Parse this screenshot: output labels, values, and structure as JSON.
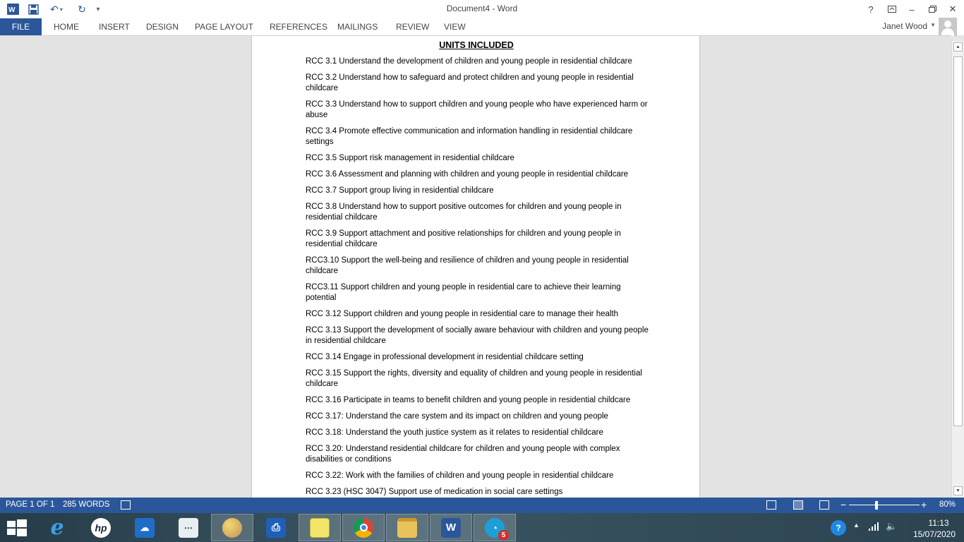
{
  "titlebar": {
    "title": "Document4 - Word"
  },
  "ribbon": {
    "file": "FILE",
    "tabs": [
      "HOME",
      "INSERT",
      "DESIGN",
      "PAGE LAYOUT",
      "REFERENCES",
      "MAILINGS",
      "REVIEW",
      "VIEW"
    ],
    "user": "Janet Wood"
  },
  "document": {
    "heading": "UNITS INCLUDED",
    "units": [
      "RCC 3.1 Understand the development of children and young people in residential childcare",
      "RCC 3.2 Understand how to safeguard and protect children and young people in residential childcare",
      "RCC 3.3 Understand how to support children and young people who have experienced harm or abuse",
      " RCC 3.4 Promote effective communication and information handling in residential childcare settings",
      "RCC 3.5 Support risk management in residential childcare",
      " RCC 3.6 Assessment and planning with children and young people in residential childcare",
      "RCC 3.7 Support group living in residential childcare",
      "RCC 3.8 Understand how to support positive outcomes for children and young people in residential childcare",
      "RCC 3.9 Support attachment and positive relationships for children and young people in residential childcare",
      "RCC3.10 Support the well-being and resilience of children and young people in residential childcare",
      "RCC3.11 Support children and young people in residential care to achieve their learning potential",
      "RCC 3.12 Support children and young people in residential care to manage their health",
      "RCC 3.13 Support the development of socially aware behaviour with children and young people in residential childcare",
      "RCC 3.14 Engage in professional development in residential childcare setting",
      "RCC 3.15 Support the rights, diversity and equality of children and young people in residential childcare",
      "RCC 3.16 Participate in teams to benefit children and young people in residential childcare",
      "RCC 3.17: Understand the care system and its impact on children and young people",
      "RCC 3.18: Understand the youth justice system as it relates to residential childcare",
      "RCC 3.20: Understand residential childcare for children and young people with complex disabilities or conditions",
      "RCC 3.22: Work with the families of children and young people in residential childcare",
      "RCC 3.23 (HSC 3047) Support use of medication in social care settings"
    ]
  },
  "statusbar": {
    "page": "PAGE 1 OF 1",
    "words": "285 WORDS",
    "zoom": "80%",
    "zoom_level": 80
  },
  "taskbar": {
    "apps": [
      "internet-explorer",
      "hp",
      "onedrive",
      "network-tool",
      "paint",
      "scanner",
      "sticky-notes",
      "chrome",
      "file-explorer",
      "word",
      "satellite-app"
    ],
    "badge": "5",
    "time": "11:13",
    "date": "15/07/2020"
  }
}
